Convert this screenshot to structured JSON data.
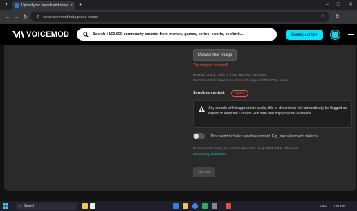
{
  "browser": {
    "tab_title": "Upload your sounds and share",
    "tab_close": "×",
    "new_tab": "+",
    "url": "tuna.voicemod.net/upload-sound",
    "site_info_icon": "tune-icon",
    "window": {
      "minimize": "–",
      "maximize": "□",
      "close": "✕"
    }
  },
  "header": {
    "logo_text": "VOICEMOD",
    "search_placeholder": "Search +150,000 community sounds from memes, games, series, sports, celebriti...",
    "create_label": "Create content",
    "accent_color": "#00e5ff"
  },
  "form": {
    "upload_image_label": "Upload new image",
    "image_error": "The image is too small",
    "image_help_1": "Must be .JPEG, .JPG or .PNG and less than 2MB",
    "image_help_2": "Recommended dimensions for sound image is 500x500px pixels.",
    "sensitive_label": "Sensitive content",
    "sensitive_badge": "Switch",
    "warning_text": "Any sounds with inappropriate audio, title or description will automatically be flagged as explicit to keep the Content Hub safe and enjoyable for everyone.",
    "toggle_label": "This sound includes sensitive content. E.g., sexual content, violence.",
    "toggle_on": false,
    "remember_text": "Remember to keep your content spam-free, respectful and to follow our",
    "guidelines_link": "Community Guidelines",
    "guidelines_suffix": ".",
    "upload_label": "Upload",
    "error_color": "#ff4d3a"
  },
  "taskbar": {
    "search_label": "Search",
    "time": "7:47 PM",
    "lang": "ENG"
  }
}
